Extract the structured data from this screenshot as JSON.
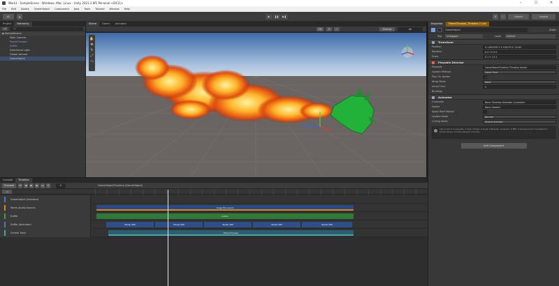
{
  "window": {
    "title": "Work1 - SampleScene - Windows, Mac, Linux - Unity 2021.2.9f1 Personal <DX11>",
    "controls": [
      "–",
      "☐",
      "✕"
    ]
  },
  "menu": [
    "File",
    "Edit",
    "Assets",
    "GameObject",
    "Component",
    "Jobs",
    "Tools",
    "Tutorial",
    "Window",
    "Help"
  ],
  "toolbar": {
    "account_label": "AC",
    "layers_label": "Layers",
    "layout_label": "Layout",
    "play": "▶",
    "pause": "❚❚",
    "step": "▶❚"
  },
  "hierarchy": {
    "tabs": [
      "Project",
      "Hierarchy"
    ],
    "search": "All",
    "items": [
      "SampleScene",
      "Main Camera",
      "FlameThrower",
      "Duffer",
      "Directional Light",
      "Global Volume",
      "GameObject"
    ]
  },
  "scene": {
    "tabs": [
      "Scene",
      "Game",
      "Animator"
    ],
    "view_toggles": [
      "2D",
      "Gizmos",
      "All"
    ]
  },
  "timeline": {
    "tabs": [
      "Console",
      "Timeline"
    ],
    "preview_label": "Preview",
    "frame": "0",
    "breadcrumb": "GameObjectTimeline (GameObject)",
    "tracks": [
      {
        "name": "GameObject (Animator)",
        "color": "#4c79c8"
      },
      {
        "name": "flame (Audio Source)",
        "color": "#d58a23"
      },
      {
        "name": "Duffer",
        "color": "#3fa045"
      },
      {
        "name": "Duffer (Animator)",
        "color": "#4c79c8"
      },
      {
        "name": "Control Track",
        "color": "#4aa3a7"
      }
    ],
    "clips": {
      "audio": "fuego fire sound",
      "activation": "Active",
      "anim": "Tweak WIP",
      "control": "FlameThrower"
    }
  },
  "inspector": {
    "tabs": [
      "Inspector",
      "Lighting",
      "Navigation"
    ],
    "title_tab": "FlameThrower_Timeline 2 (cla",
    "object_name": "GameObject",
    "static_label": "Static",
    "tag_label": "Tag",
    "tag_value": "Untagged",
    "layer_label": "Layer",
    "layer_value": "Default",
    "transform": {
      "header": "Transform",
      "rows": [
        {
          "label": "Position",
          "value": "X 1.853035   Y 1.704279   Z -22.85"
        },
        {
          "label": "Rotation",
          "value": "X 0   Y 0   Z 0"
        },
        {
          "label": "Scale",
          "value": "X 1   Y 1   Z 1"
        }
      ]
    },
    "playable": {
      "header": "Playable Director",
      "rows": [
        {
          "label": "Playable",
          "value": "GameObjectTimeline (Timeline Asset)"
        },
        {
          "label": "Update Method",
          "value": "Game Time"
        },
        {
          "label": "Play On Awake",
          "value": "✓"
        },
        {
          "label": "Wrap Mode",
          "value": "None"
        },
        {
          "label": "Initial Time",
          "value": "0"
        }
      ],
      "bindings": "Bindings"
    },
    "animator": {
      "header": "Animator",
      "rows": [
        {
          "label": "Controller",
          "value": "None (Runtime Animator Controller)"
        },
        {
          "label": "Avatar",
          "value": "None (Avatar)"
        },
        {
          "label": "Apply Root Motion",
          "value": ""
        },
        {
          "label": "Update Mode",
          "value": "Normal"
        },
        {
          "label": "Culling Mode",
          "value": "Always Animate"
        }
      ],
      "note": "Clip Count: 0 Curves Pos: 0 Quat: 0 Euler: 0 Scale: 0 Muscles: 0 Generic: 0 PPtr: 0 Curves Count: 0 Constant: 0 (0.0%) Dense: 0 (0.0%) Stream: 0 (0.0%)"
    },
    "add_component": "Add Component"
  }
}
